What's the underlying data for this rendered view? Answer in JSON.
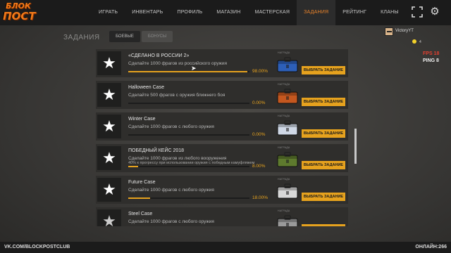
{
  "logo": {
    "line1": "БЛОК",
    "line2": "ПОСТ"
  },
  "nav": [
    {
      "label": "ИГРАТЬ",
      "active": false
    },
    {
      "label": "ИНВЕНТАРЬ",
      "active": false
    },
    {
      "label": "ПРОФИЛЬ",
      "active": false
    },
    {
      "label": "МАГАЗИН",
      "active": false
    },
    {
      "label": "МАСТЕРСКАЯ",
      "active": false
    },
    {
      "label": "ЗАДАНИЯ",
      "active": true
    },
    {
      "label": "РЕЙТИНГ",
      "active": false
    },
    {
      "label": "КЛАНЫ",
      "active": false
    }
  ],
  "icons": {
    "fullscreen": "fullscreen-icon",
    "settings": "gear-icon"
  },
  "page": {
    "title": "ЗАДАНИЯ",
    "tab_combat": "БОЕВЫЕ",
    "tab_bonus": "БОНУСЫ"
  },
  "user": {
    "name": "VictoryYT",
    "coins": "4",
    "fps": "FPS 18",
    "ping": "PING 8"
  },
  "reward_label": "НАГРАДА",
  "button_label": "ВЫБРАТЬ ЗАДАНИЕ",
  "quests": [
    {
      "title": "«СДЕЛАНО В РОССИИ 2»",
      "desc": "Сделайте 1000 фрагов из российского оружия",
      "desc2": "",
      "progress": 0.98,
      "pct": "98.00%",
      "case_color": "#2d5fb8",
      "star": "#ffffff"
    },
    {
      "title": "Halloween Case",
      "desc": "Сделайте 500 фрагов с оружия ближнего боя",
      "desc2": "",
      "progress": 0.0,
      "pct": "0.00%",
      "case_color": "#c4571f",
      "star": "#ffffff"
    },
    {
      "title": "Winter Case",
      "desc": "Сделайте 1000 фрагов с любого оружия",
      "desc2": "",
      "progress": 0.0,
      "pct": "0.00%",
      "case_color": "#cfd8e6",
      "star": "#ffffff"
    },
    {
      "title": "ПОБЕДНЫЙ КЕЙС 2018",
      "desc": "Сделайте 1000 фрагов из любого вооружения",
      "desc2": "40% к прогрессу при использовании оружия с победным камуфляжем",
      "progress": 0.08,
      "pct": "8.00%",
      "case_color": "#5e7a2e",
      "star": "#ffffff"
    },
    {
      "title": "Future Case",
      "desc": "Сделайте 1000 фрагов с любого оружия",
      "desc2": "",
      "progress": 0.18,
      "pct": "18.00%",
      "case_color": "#d8d8d8",
      "star": "#ffffff"
    },
    {
      "title": "Steel Case",
      "desc": "Сделайте 1000 фрагов с любого оружия",
      "desc2": "",
      "progress": 0.0,
      "pct": "",
      "case_color": "#9a9a9a",
      "star": "#cccccc"
    }
  ],
  "footer": {
    "left": "VK.COM/BLOCKPOSTCLUB",
    "right": "ОНЛАЙН:266"
  }
}
